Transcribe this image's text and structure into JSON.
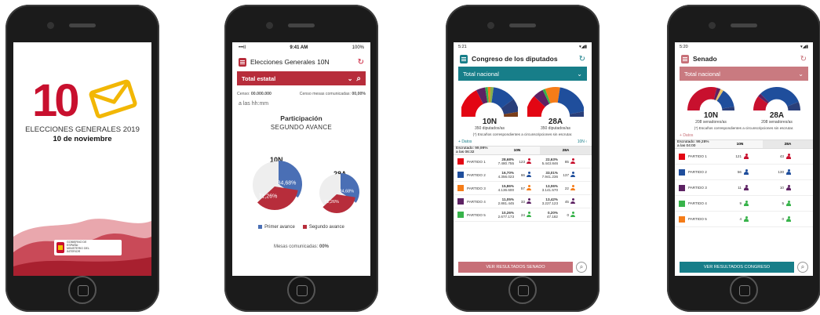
{
  "splash": {
    "big_number": "10",
    "line1": "ELECCIONES GENERALES 2019",
    "line2": "10 de noviembre",
    "gov_text": "GOBIERNO DE ESPAÑA · MINISTERIO DEL INTERIOR"
  },
  "general": {
    "status_left": "•••ll",
    "status_time": "9:41 AM",
    "status_right": "100%",
    "title": "Elecciones Generales",
    "title_tag": "10N",
    "scope": "Total estatal",
    "censo_label": "Censo:",
    "censo_value": "00.000.000",
    "mesas_censo_label": "Censo mesas comunicadas:",
    "mesas_censo_value": "00,00%",
    "hora": "a las hh:mm",
    "participacion": "Participación",
    "avance": "SEGUNDO AVANCE",
    "label_10n": "10N",
    "label_28a": "28A",
    "legend_first": "Primer avance",
    "legend_second": "Segundo avance",
    "mesas": "Mesas comunicadas:",
    "mesas_value": "00%",
    "pie_10n": {
      "first": "34,68%",
      "second": "71,26%",
      "first_value": 34.68,
      "second_value": 71.26
    },
    "pie_28a": {
      "first": "34,68%",
      "second": "71,26%",
      "first_value": 34.68,
      "second_value": 71.26
    }
  },
  "congreso": {
    "status_time": "5:21",
    "title": "Congreso de los diputados",
    "scope": "Total nacional",
    "hemi_left": "10N",
    "hemi_left_sub": "350 diputados/as",
    "hemi_right": "28A",
    "hemi_right_sub": "350 diputados/as",
    "note": "(*) Escaños correspondientes a circunscripciones sin escrutar.",
    "datos": "Datos",
    "datos_right": "10N",
    "escrutado": "Escrutado: 99,99%",
    "escrutado_time": "a las 06:32",
    "col_10n": "10N",
    "col_28a": "28A",
    "rows": [
      {
        "name": "PARTIDO 1",
        "color": "#e30613",
        "p1": "28,68%",
        "v1": "7.480.755",
        "s1": "123",
        "p2": "22,63%",
        "v2": "5.443.846",
        "s2": "85",
        "pc": "#c8102e"
      },
      {
        "name": "PARTIDO 2",
        "color": "#1f4e9c",
        "p1": "16,70%",
        "v1": "4.356.023",
        "s1": "66",
        "p2": "33,01%",
        "v2": "7.941.236",
        "s2": "137",
        "pc": "#1f4e9c"
      },
      {
        "name": "PARTIDO 3",
        "color": "#f57c18",
        "p1": "15,86%",
        "v1": "4.136.600",
        "s1": "57",
        "p2": "13,06%",
        "v2": "3.141.570",
        "s2": "22",
        "pc": "#f57c18"
      },
      {
        "name": "PARTIDO 4",
        "color": "#5d2263",
        "p1": "11,05%",
        "v1": "2.881.445",
        "s1": "33",
        "p2": "13,42%",
        "v2": "3.227.123",
        "s2": "45",
        "pc": "#5d2263"
      },
      {
        "name": "PARTIDO 5",
        "color": "#37b34a",
        "p1": "10,26%",
        "v1": "2.677.173",
        "s1": "24",
        "p2": "0,20%",
        "v2": "47.182",
        "s2": "0",
        "pc": "#37b34a"
      }
    ],
    "button": "VER RESULTADOS SENADO"
  },
  "senado": {
    "status_time": "5:20",
    "title": "Senado",
    "scope": "Total nacional",
    "hemi_left": "10N",
    "hemi_left_sub": "208 senadores/as",
    "hemi_right": "28A",
    "hemi_right_sub": "208 senadores/as",
    "note": "(*) Escaños correspondientes a circunscripciones sin escrutar.",
    "datos": "Datos",
    "escrutado": "Escrutado: 99,28%",
    "escrutado_time": "a las 04:00",
    "col_10n": "10N",
    "col_28a": "28A",
    "rows": [
      {
        "name": "PARTIDO 1",
        "color": "#e30613",
        "s1": "121",
        "s2": "43",
        "pc": "#c8102e"
      },
      {
        "name": "PARTIDO 2",
        "color": "#1f4e9c",
        "s1": "56",
        "s2": "130",
        "pc": "#1f4e9c"
      },
      {
        "name": "PARTIDO 3",
        "color": "#5d2263",
        "s1": "11",
        "s2": "10",
        "pc": "#5d2263"
      },
      {
        "name": "PARTIDO 4",
        "color": "#37b34a",
        "s1": "9",
        "s2": "5",
        "pc": "#37b34a"
      },
      {
        "name": "PARTIDO 5",
        "color": "#f57c18",
        "s1": "4",
        "s2": "0",
        "pc": "#37b34a"
      }
    ],
    "button": "VER RESULTADOS CONGRESO"
  },
  "colors": {
    "brand_red": "#b72d3b",
    "teal": "#177e89",
    "pink_bar": "#c76f77",
    "first_avance": "#4a6fb5",
    "second_avance": "#b72d3b"
  }
}
